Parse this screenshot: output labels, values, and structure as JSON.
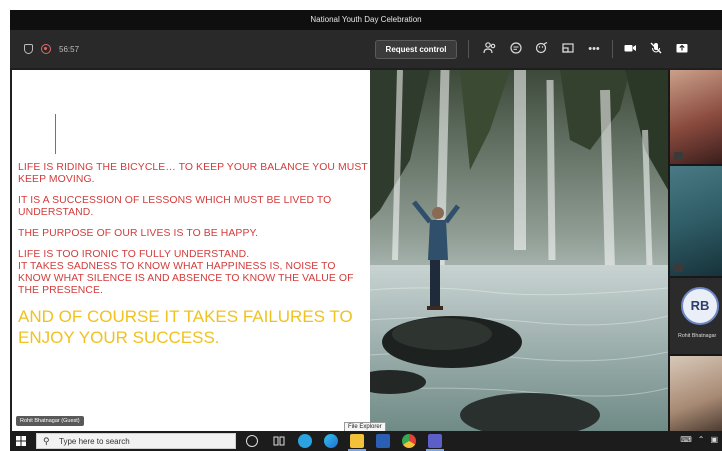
{
  "meeting": {
    "title": "National Youth Day Celebration",
    "timer": "56:57",
    "request_control_label": "Request control"
  },
  "controls": {
    "people_icon": "people-icon",
    "chat_icon": "chat-icon",
    "reactions_icon": "reactions-icon",
    "rooms_icon": "rooms-icon",
    "more_label": "•••",
    "camera_icon": "camera-icon",
    "mic_icon": "mic-off-icon",
    "share_icon": "share-icon"
  },
  "slide": {
    "quotes": [
      "LIFE IS RIDING THE BICYCLE… TO KEEP YOUR BALANCE YOU MUST KEEP MOVING.",
      "IT IS A SUCCESSION OF LESSONS WHICH MUST BE LIVED TO UNDERSTAND.",
      "THE PURPOSE OF OUR LIVES IS TO BE HAPPY.",
      "LIFE IS TOO IRONIC TO FULLY UNDERSTAND.",
      "IT TAKES SADNESS TO KNOW WHAT HAPPINESS IS, NOISE TO KNOW WHAT SILENCE IS AND ABSENCE TO KNOW THE VALUE OF THE PRESENCE."
    ],
    "closing": "AND OF COURSE IT TAKES FAILURES TO ENJOY YOUR SUCCESS.",
    "presenter_tag": "Rohit Bhatnagar (Guest)"
  },
  "participants": [
    {
      "initials": "",
      "name": ""
    },
    {
      "initials": "",
      "name": ""
    },
    {
      "initials": "RB",
      "name": "Rohit Bhatnagar"
    },
    {
      "initials": "",
      "name": ""
    }
  ],
  "taskbar": {
    "search_placeholder": "Type here to search",
    "tooltip": "File Explorer"
  },
  "colors": {
    "quote_red": "#d33b3b",
    "closing_yellow": "#f0c21f",
    "accent_blue": "#6c86c6"
  }
}
